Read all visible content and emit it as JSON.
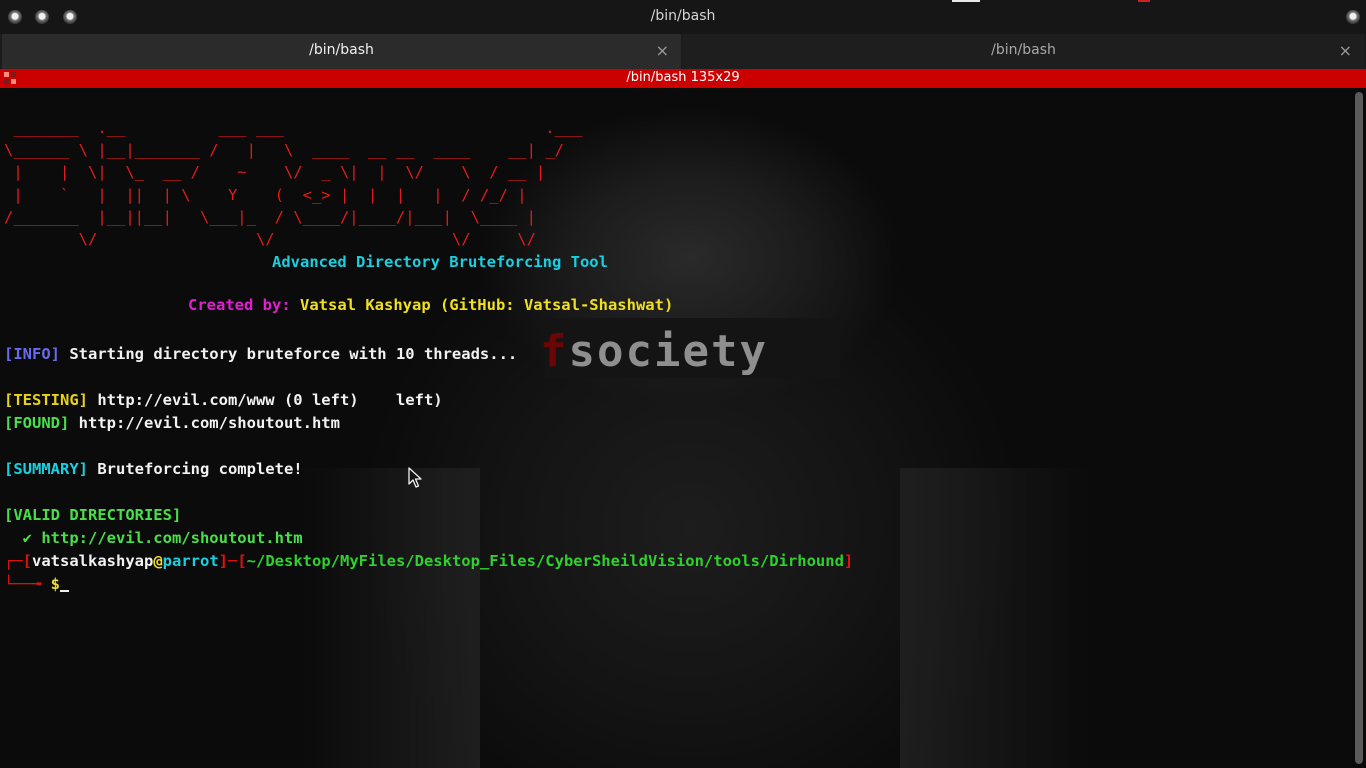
{
  "window": {
    "title": "/bin/bash"
  },
  "tabs": [
    {
      "label": "/bin/bash",
      "active": true
    },
    {
      "label": "/bin/bash",
      "active": false
    }
  ],
  "tab_close_glyph": "×",
  "terminal": {
    "header_title": "/bin/bash 135x29",
    "background_text": "fsociety",
    "banner": [
      " _______  .__          ___ ___                            .___",
      "\\______ \\ |__|_______ /   |   \\  ____  __ __  ____    __| _/",
      " |    |  \\|  \\_  __ /    ~    \\/  _ \\|  |  \\/    \\  / __ |",
      " |    `   |  ||  | \\    Y    (  <_> |  |  |   |  / /_/ |",
      "/_______  |__||__|   \\___|_  / \\____/|____/|___|  \\____ |",
      "        \\/                 \\/                   \\/     \\/"
    ],
    "subtitle": "Advanced Directory Bruteforcing Tool",
    "credit_label": "Created by:",
    "credit_value": "Vatsal Kashyap (GitHub: Vatsal-Shashwat)",
    "info_tag": "[INFO]",
    "info_text": " Starting directory bruteforce with 10 threads...",
    "testing_tag": "[TESTING]",
    "testing_text": " http://evil.com/www (0 left)    left)",
    "found_tag": "[FOUND]",
    "found_text": " http://evil.com/shoutout.htm",
    "summary_tag": "[SUMMARY]",
    "summary_text": " Bruteforcing complete!",
    "valid_header": "[VALID DIRECTORIES]",
    "valid_item": "  ✔ http://evil.com/shoutout.htm",
    "prompt": {
      "user": "vatsalkashyap",
      "at": "@",
      "host": "parrot",
      "path": "~/Desktop/MyFiles/Desktop_Files/CyberSheildVision/tools/Dirhound",
      "symbol": "$"
    }
  },
  "colors": {
    "terminal_header": "#cc0000",
    "banner": "#e31c1c",
    "subtitle": "#18d0e0",
    "credit_label": "#e020d0",
    "credit_value": "#f0e020",
    "info": "#6a6af0",
    "testing": "#e8d21a",
    "found": "#48e048",
    "summary": "#18d0e0",
    "valid": "#48e048"
  }
}
